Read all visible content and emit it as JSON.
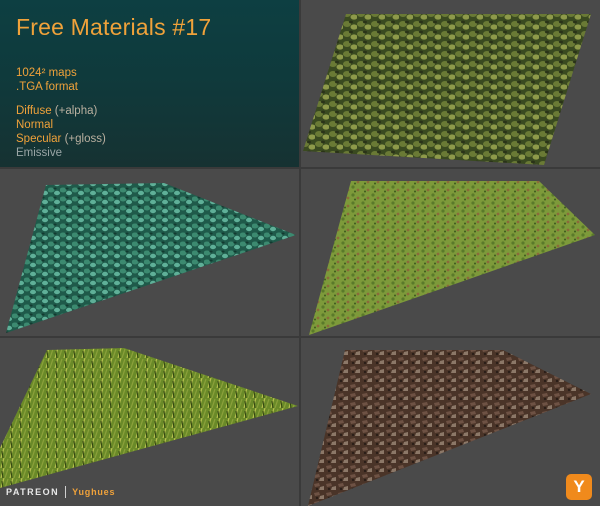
{
  "header": {
    "title": "Free Materials #17",
    "maps": "1024² maps",
    "format": ".TGA format",
    "diffuse": "Diffuse",
    "diffuse_note": "(+alpha)",
    "normal": "Normal",
    "specular": "Specular",
    "specular_note": "(+gloss)",
    "emissive": "Emissive"
  },
  "footer": {
    "patreon": "PATREON",
    "author": "Yughues",
    "logo_letter": "Y"
  },
  "colors": {
    "accent": "#f0a23a",
    "panel_bg": "#0f3a3c",
    "viewport_bg": "#4a4a4a"
  },
  "materials": [
    {
      "name": "ivy-leaves",
      "colors": [
        "#3a4a20",
        "#6a7a35",
        "#8e9a4a",
        "#2a3318"
      ]
    },
    {
      "name": "teal-leaves",
      "colors": [
        "#1f5a4a",
        "#3c8a70",
        "#5fb098",
        "#123a30"
      ]
    },
    {
      "name": "green-grass",
      "colors": [
        "#5a7a2a",
        "#7d9a3a",
        "#8b6a3a",
        "#3e5a1e"
      ]
    },
    {
      "name": "tall-grass",
      "colors": [
        "#4a6a1a",
        "#8aa03a",
        "#b8c050",
        "#2e4210"
      ]
    },
    {
      "name": "bark-mulch",
      "colors": [
        "#4a3428",
        "#6e5244",
        "#8c7868",
        "#2a1e18"
      ]
    }
  ]
}
